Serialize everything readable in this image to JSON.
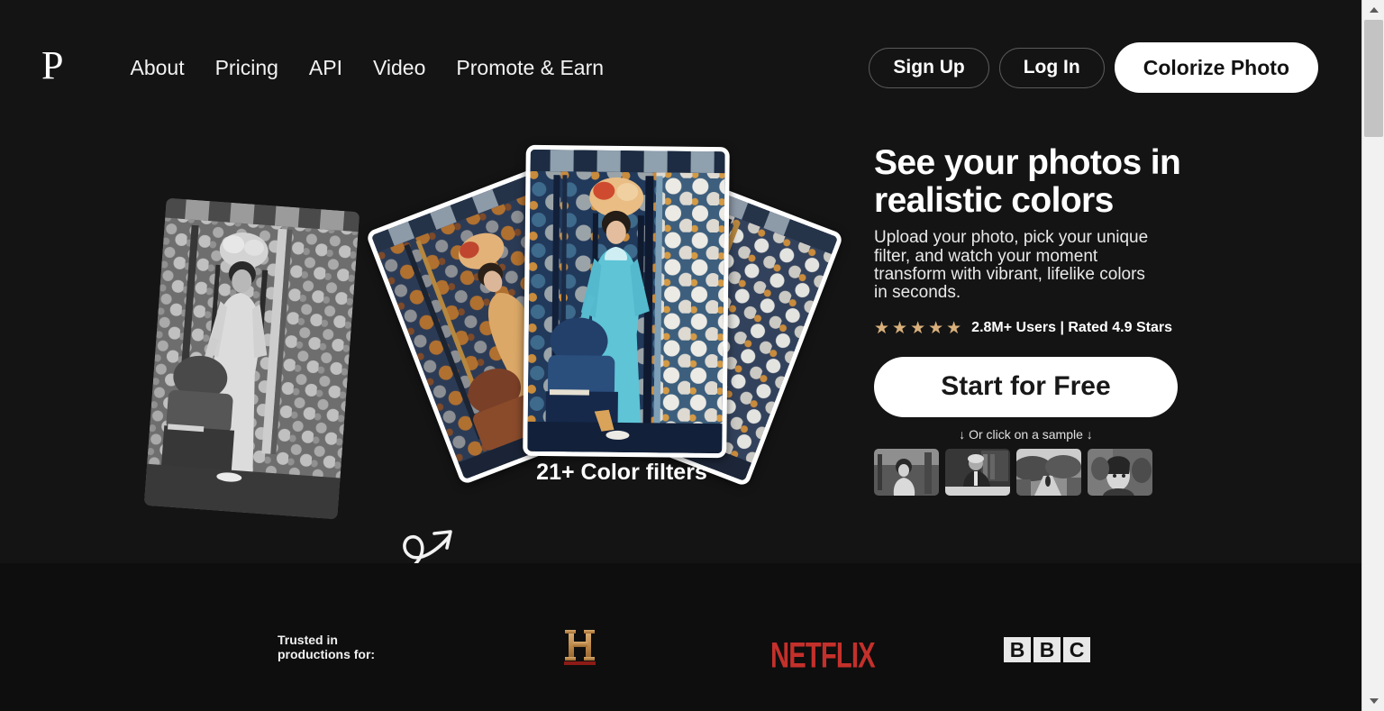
{
  "theme": {
    "background": "#141414",
    "footer_background": "#0e0e0e",
    "accent_white": "#ffffff",
    "star_color": "#d9b07c",
    "netflix_red": "#c4302b",
    "history_gold": "#c89a5b"
  },
  "header": {
    "logo_text": "P",
    "nav": [
      {
        "label": "About"
      },
      {
        "label": "Pricing"
      },
      {
        "label": "API"
      },
      {
        "label": "Video"
      },
      {
        "label": "Promote & Earn"
      }
    ],
    "sign_up_label": "Sign Up",
    "log_in_label": "Log In",
    "colorize_label": "Colorize Photo"
  },
  "hero": {
    "headline": "See your photos in realistic colors",
    "subhead": "Upload your photo, pick your unique filter, and watch your moment transform with vibrant, lifelike colors in seconds.",
    "stars_glyphs": "★★★★★",
    "star_count": 5,
    "rating_text": "2.8M+ Users | Rated 4.9 Stars",
    "cta_label": "Start for Free",
    "sample_hint": "↓ Or click on a sample ↓",
    "filters_caption": "21+ Color filters",
    "samples": [
      {
        "name": "sample-woman-outdoors"
      },
      {
        "name": "sample-man-at-desk"
      },
      {
        "name": "sample-garden-path"
      },
      {
        "name": "sample-migrant-mother"
      }
    ]
  },
  "footer": {
    "trusted_line1": "Trusted in",
    "trusted_line2": "productions for:",
    "brands": [
      {
        "name": "history-channel",
        "label": "H"
      },
      {
        "name": "netflix",
        "label": "NETFLIX"
      },
      {
        "name": "bbc",
        "label": "BBC",
        "letters": [
          "B",
          "B",
          "C"
        ]
      }
    ]
  },
  "scrollbar": {
    "up_arrow": "scroll-up-arrow",
    "down_arrow": "scroll-down-arrow"
  }
}
